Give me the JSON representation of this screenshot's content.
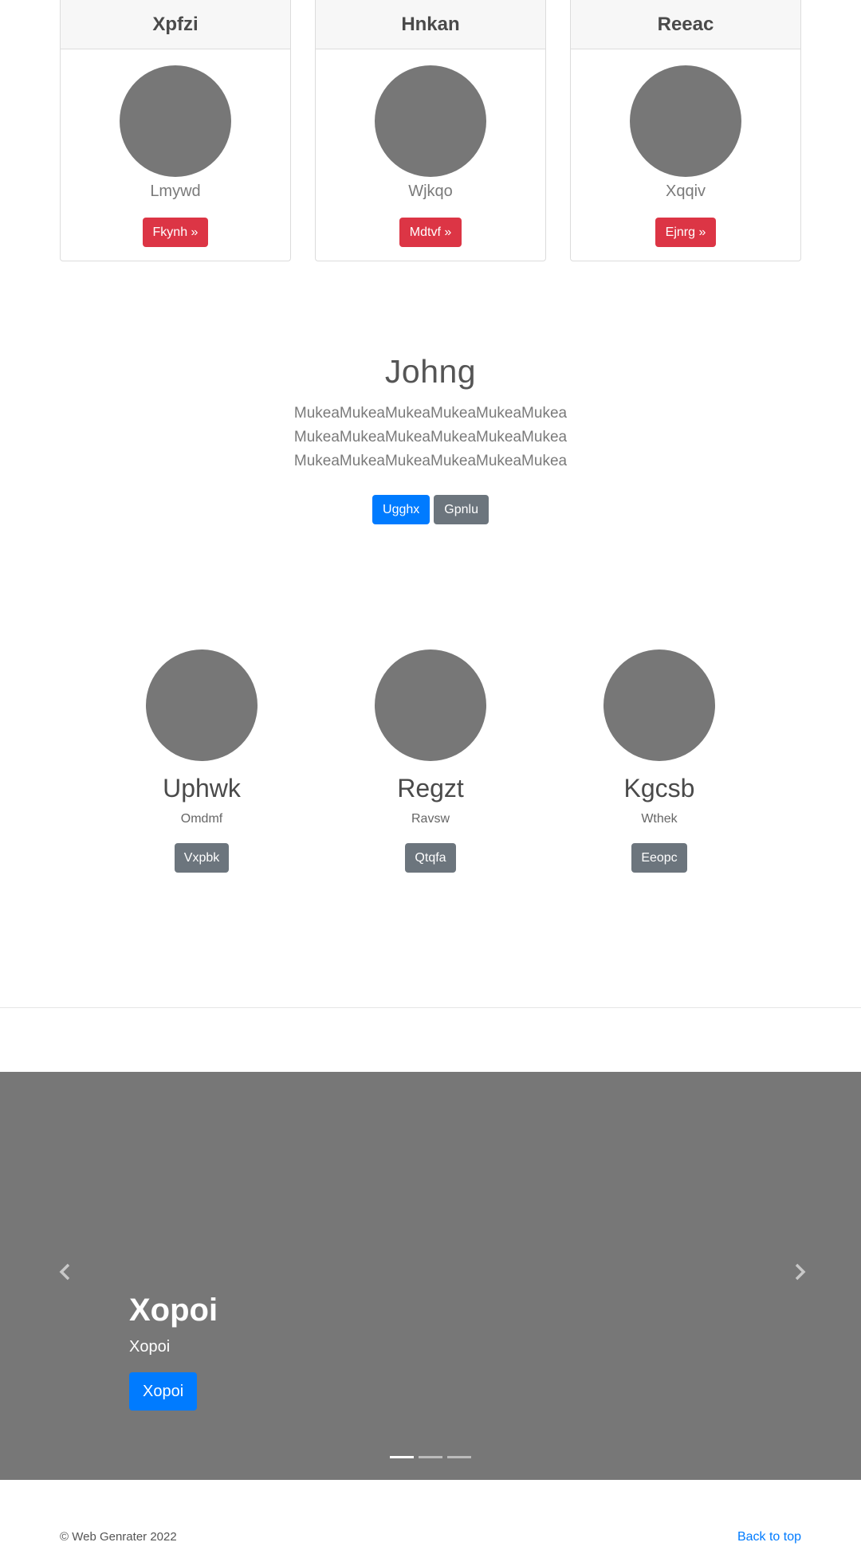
{
  "cards": [
    {
      "title": "Xpfzi",
      "text": "Lmywd",
      "button": "Fkynh »"
    },
    {
      "title": "Hnkan",
      "text": "Wjkqo",
      "button": "Mdtvf »"
    },
    {
      "title": "Reeac",
      "text": "Xqqiv",
      "button": "Ejnrg »"
    }
  ],
  "jumbotron": {
    "heading": "Johng",
    "lead": "MukeaMukeaMukeaMukeaMukeaMukeaMukeaMukeaMukeaMukeaMukeaMukeaMukeaMukeaMukeaMukeaMukeaMukea",
    "primary_button": "Ugghx",
    "secondary_button": "Gpnlu"
  },
  "marketing": [
    {
      "heading": "Uphwk",
      "text": "Omdmf",
      "button": "Vxpbk"
    },
    {
      "heading": "Regzt",
      "text": "Ravsw",
      "button": "Qtqfa"
    },
    {
      "heading": "Kgcsb",
      "text": "Wthek",
      "button": "Eeopc"
    }
  ],
  "carousel": {
    "heading": "Xopoi",
    "text": "Xopoi",
    "button": "Xopoi",
    "slide_count": 3,
    "active_slide": 1
  },
  "footer": {
    "copyright": "© Web Genrater 2022",
    "back_to_top": "Back to top"
  },
  "colors": {
    "placeholder": "#777777",
    "danger": "#dc3545",
    "primary": "#007bff",
    "secondary": "#6c757d"
  }
}
